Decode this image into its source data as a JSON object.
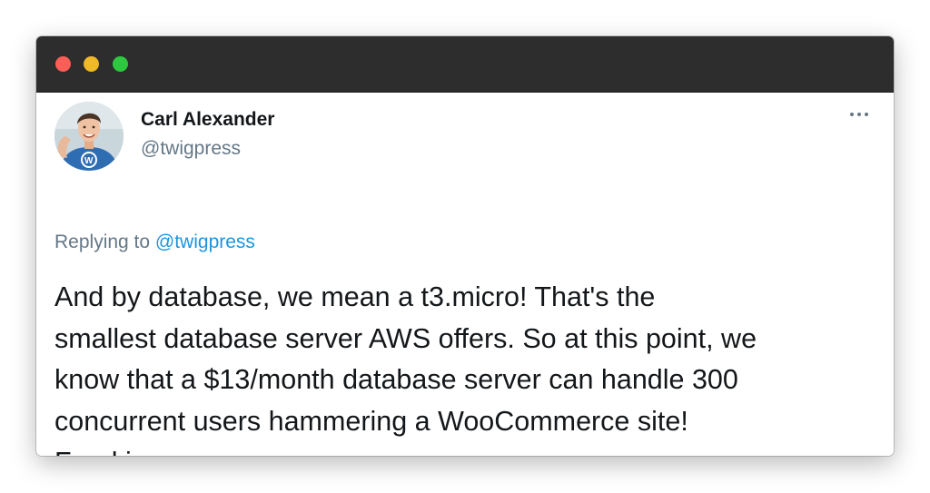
{
  "window": {
    "controls": [
      "close",
      "minimize",
      "maximize"
    ]
  },
  "tweet": {
    "author_name": "Carl Alexander",
    "author_handle": "@twigpress",
    "more_icon": "more-horizontal-icon",
    "replying_prefix": "Replying to",
    "replying_to": "@twigpress",
    "text_lines": [
      "And by database, we mean a t3.micro! That's the",
      "smallest database server AWS offers. So at this point, we",
      "know that a $13/month database server can handle 300",
      "concurrent users hammering a WooCommerce site!",
      "Freaking awesome."
    ]
  },
  "colors": {
    "titlebar": "#2d2d2d",
    "close": "#fd5e57",
    "minimize": "#f0b928",
    "maximize": "#2dc83f",
    "link": "#1b95e0",
    "secondary_text": "#657786",
    "primary_text": "#14171a"
  }
}
